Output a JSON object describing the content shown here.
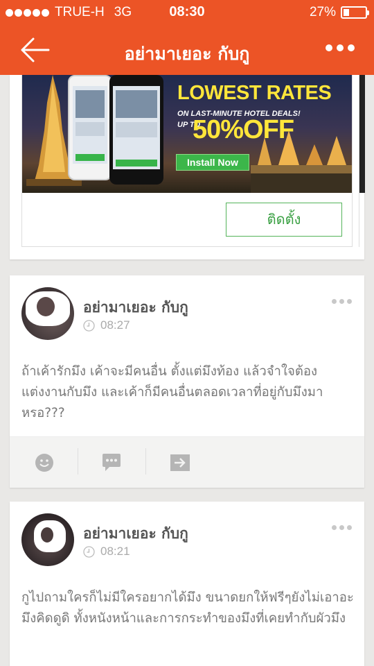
{
  "status_bar": {
    "carrier": "TRUE-H",
    "network": "3G",
    "time": "08:30",
    "battery": "27%",
    "battery_level": 0.27
  },
  "nav": {
    "title": "อย่ามาเยอะ กับกู",
    "back_icon": "back-arrow-icon",
    "more_icon": "more-dots-icon"
  },
  "ad": {
    "headline": "LOWEST RATES",
    "subline": "ON LAST-MINUTE HOTEL DEALS!",
    "upto": "UP TO",
    "discount": "50%OFF",
    "install_now": "Install Now",
    "install_button": "ติดตั้ง"
  },
  "posts": [
    {
      "author": "อย่ามาเยอะ กับกู",
      "time": "08:27",
      "text": "ถ้าเค้ารักมึง เค้าจะมีคนอื่น ตั้งแต่มึงท้อง แล้วจำใจต้องแต่งงานกับมึง และเค้าก็มีคนอื่นตลอดเวลาที่อยู่กับมึงมาหรอ???",
      "actions": [
        "smiley-icon",
        "comment-icon",
        "share-icon"
      ]
    },
    {
      "author": "อย่ามาเยอะ กับกู",
      "time": "08:21",
      "text": "กูไปถามใครก็ไม่มีใครอยากได้มึง ขนาดยกให้ฟรีๆยังไม่เอาอะ มึงคิดดูดิ ทั้งหนังหน้าและการกระทำของมึงที่เคยทำกับผัวมึง"
    }
  ],
  "colors": {
    "accent": "#ec5426",
    "install_green": "#3aa043",
    "text_gray": "#777777"
  }
}
